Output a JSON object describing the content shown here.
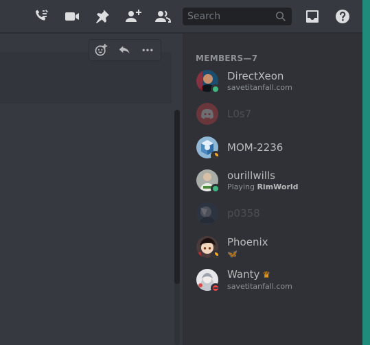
{
  "header": {
    "search_placeholder": "Search",
    "icons": [
      "threads-icon",
      "video-call-icon",
      "pin-icon",
      "add-member-icon",
      "member-list-icon",
      "inbox-icon",
      "help-icon"
    ]
  },
  "toolbar": {
    "icons": [
      "add-reaction-icon",
      "reply-icon",
      "more-icon"
    ]
  },
  "members": {
    "title": "MEMBERS—7",
    "list": [
      {
        "name": "DirectXeon",
        "sub": "savetitanfall.com",
        "status": "online",
        "offline": false
      },
      {
        "name": "L0s7",
        "sub": "",
        "status": "none",
        "offline": true
      },
      {
        "name": "MOM-2236",
        "sub": "",
        "status": "idle",
        "offline": false
      },
      {
        "name": "ourillwills",
        "sub_prefix": "Playing ",
        "sub_bold": "RimWorld",
        "status": "online",
        "offline": false
      },
      {
        "name": "p0358",
        "sub": "",
        "status": "none",
        "offline": true
      },
      {
        "name": "Phoenix",
        "sub": "🦋",
        "status": "idle",
        "offline": false
      },
      {
        "name": "Wanty",
        "sub": "savetitanfall.com",
        "status": "dnd",
        "offline": false,
        "crown": "♛"
      }
    ]
  },
  "colors": {
    "background": "#36393f",
    "sidebar": "#2f3136",
    "online": "#43b581",
    "idle": "#faa61a",
    "dnd": "#f04747",
    "accent_strip": "#1f8b7a"
  }
}
